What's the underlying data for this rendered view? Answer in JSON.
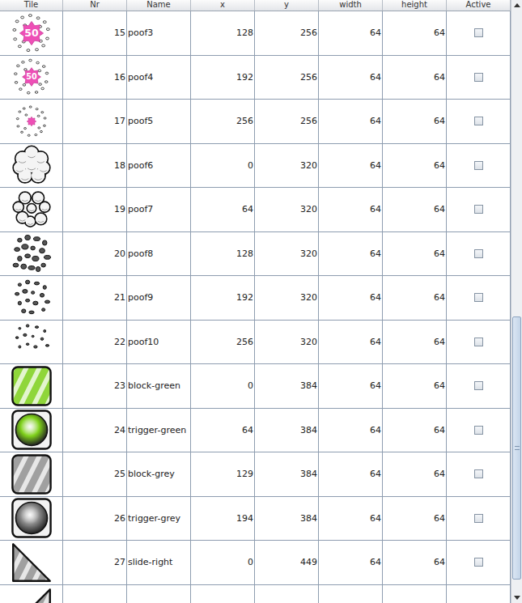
{
  "table": {
    "columns": [
      "Tile",
      "Nr",
      "Name",
      "x",
      "y",
      "width",
      "height",
      "Active"
    ],
    "rows": [
      {
        "nr": "15",
        "name": "poof3",
        "x": "128",
        "y": "256",
        "width": "64",
        "height": "64",
        "active": false,
        "kind": "poof-star-large",
        "badge": "50"
      },
      {
        "nr": "16",
        "name": "poof4",
        "x": "192",
        "y": "256",
        "width": "64",
        "height": "64",
        "active": false,
        "kind": "poof-star-medium",
        "badge": "50"
      },
      {
        "nr": "17",
        "name": "poof5",
        "x": "256",
        "y": "256",
        "width": "64",
        "height": "64",
        "active": false,
        "kind": "poof-star-small"
      },
      {
        "nr": "18",
        "name": "poof6",
        "x": "0",
        "y": "320",
        "width": "64",
        "height": "64",
        "active": false,
        "kind": "cloud-large"
      },
      {
        "nr": "19",
        "name": "poof7",
        "x": "64",
        "y": "320",
        "width": "64",
        "height": "64",
        "active": false,
        "kind": "cloud-split"
      },
      {
        "nr": "20",
        "name": "poof8",
        "x": "128",
        "y": "320",
        "width": "64",
        "height": "64",
        "active": false,
        "kind": "rubble-large"
      },
      {
        "nr": "21",
        "name": "poof9",
        "x": "192",
        "y": "320",
        "width": "64",
        "height": "64",
        "active": false,
        "kind": "rubble-medium"
      },
      {
        "nr": "22",
        "name": "poof10",
        "x": "256",
        "y": "320",
        "width": "64",
        "height": "64",
        "active": false,
        "kind": "rubble-small"
      },
      {
        "nr": "23",
        "name": "block-green",
        "x": "0",
        "y": "384",
        "width": "64",
        "height": "64",
        "active": false,
        "kind": "block",
        "color": "#8fd63a"
      },
      {
        "nr": "24",
        "name": "trigger-green",
        "x": "64",
        "y": "384",
        "width": "64",
        "height": "64",
        "active": false,
        "kind": "trigger",
        "color": "#7fd11b"
      },
      {
        "nr": "25",
        "name": "block-grey",
        "x": "129",
        "y": "384",
        "width": "64",
        "height": "64",
        "active": false,
        "kind": "block",
        "color": "#a0a0a0"
      },
      {
        "nr": "26",
        "name": "trigger-grey",
        "x": "194",
        "y": "384",
        "width": "64",
        "height": "64",
        "active": false,
        "kind": "trigger",
        "color": "#8a8a8a"
      },
      {
        "nr": "27",
        "name": "slide-right",
        "x": "0",
        "y": "449",
        "width": "64",
        "height": "64",
        "active": false,
        "kind": "slide-right",
        "color": "#a0a0a0"
      }
    ],
    "partial_row": {
      "kind": "slide-left",
      "color": "#a0a0a0"
    }
  }
}
